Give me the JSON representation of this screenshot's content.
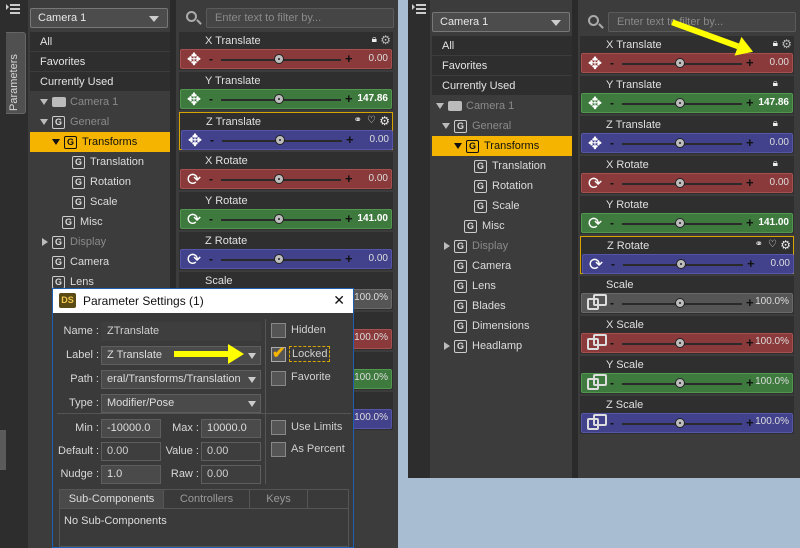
{
  "left_panel": {
    "side_tab": "Parameters",
    "node_selector": "Camera 1",
    "filter_placeholder": "Enter text to filter by...",
    "categories": [
      "All",
      "Favorites",
      "Currently Used"
    ],
    "tree": [
      {
        "label": "Camera 1"
      },
      {
        "label": "General"
      },
      {
        "label": "Transforms"
      },
      {
        "label": "Translation"
      },
      {
        "label": "Rotation"
      },
      {
        "label": "Scale"
      },
      {
        "label": "Misc"
      },
      {
        "label": "Display"
      },
      {
        "label": "Camera"
      },
      {
        "label": "Lens"
      }
    ],
    "params": [
      {
        "name": "X Translate",
        "value": "0.00"
      },
      {
        "name": "Y Translate",
        "value": "147.86"
      },
      {
        "name": "Z Translate",
        "value": "0.00"
      },
      {
        "name": "X Rotate",
        "value": "0.00"
      },
      {
        "name": "Y Rotate",
        "value": "141.00"
      },
      {
        "name": "Z Rotate",
        "value": "0.00"
      },
      {
        "name": "Scale",
        "value": "100.0%"
      }
    ],
    "partial_values": [
      "100.0%",
      "100.0%",
      "100.0%"
    ]
  },
  "dialog": {
    "title": "Parameter Settings (1)",
    "close": "✕",
    "name_label": "Name :",
    "name_value": "ZTranslate",
    "label_label": "Label :",
    "label_value": "Z Translate",
    "path_label": "Path :",
    "path_value": "eral/Transforms/Translation",
    "type_label": "Type :",
    "type_value": "Modifier/Pose",
    "min_label": "Min :",
    "min_value": "-10000.0",
    "max_label": "Max :",
    "max_value": "10000.0",
    "default_label": "Default :",
    "default_value": "0.00",
    "value_label": "Value :",
    "value_value": "0.00",
    "nudge_label": "Nudge :",
    "nudge_value": "1.0",
    "raw_label": "Raw :",
    "raw_value": "0.00",
    "checks": {
      "hidden": "Hidden",
      "locked": "Locked",
      "favorite": "Favorite",
      "use_limits": "Use Limits",
      "as_percent": "As Percent"
    },
    "tabs": [
      "Sub-Components",
      "Controllers",
      "Keys"
    ],
    "content": "No Sub-Components"
  },
  "right_panel": {
    "node_selector": "Camera 1",
    "filter_placeholder": "Enter text to filter by...",
    "categories": [
      "All",
      "Favorites",
      "Currently Used"
    ],
    "tree": [
      {
        "label": "Camera 1"
      },
      {
        "label": "General"
      },
      {
        "label": "Transforms"
      },
      {
        "label": "Translation"
      },
      {
        "label": "Rotation"
      },
      {
        "label": "Scale"
      },
      {
        "label": "Misc"
      },
      {
        "label": "Display"
      },
      {
        "label": "Camera"
      },
      {
        "label": "Lens"
      },
      {
        "label": "Blades"
      },
      {
        "label": "Dimensions"
      },
      {
        "label": "Headlamp"
      }
    ],
    "params": [
      {
        "name": "X Translate",
        "value": "0.00"
      },
      {
        "name": "Y Translate",
        "value": "147.86"
      },
      {
        "name": "Z Translate",
        "value": "0.00"
      },
      {
        "name": "X Rotate",
        "value": "0.00"
      },
      {
        "name": "Y Rotate",
        "value": "141.00"
      },
      {
        "name": "Z Rotate",
        "value": "0.00"
      },
      {
        "name": "Scale",
        "value": "100.0%"
      },
      {
        "name": "X Scale",
        "value": "100.0%"
      },
      {
        "name": "Y Scale",
        "value": "100.0%"
      },
      {
        "name": "Z Scale",
        "value": "100.0%"
      }
    ]
  },
  "colors": {
    "red": "#8a3a3a",
    "green": "#3e7a3e",
    "blue": "#42428c",
    "gray": "#555555",
    "selection": "#f5b400",
    "arrow": "#ffff00"
  }
}
